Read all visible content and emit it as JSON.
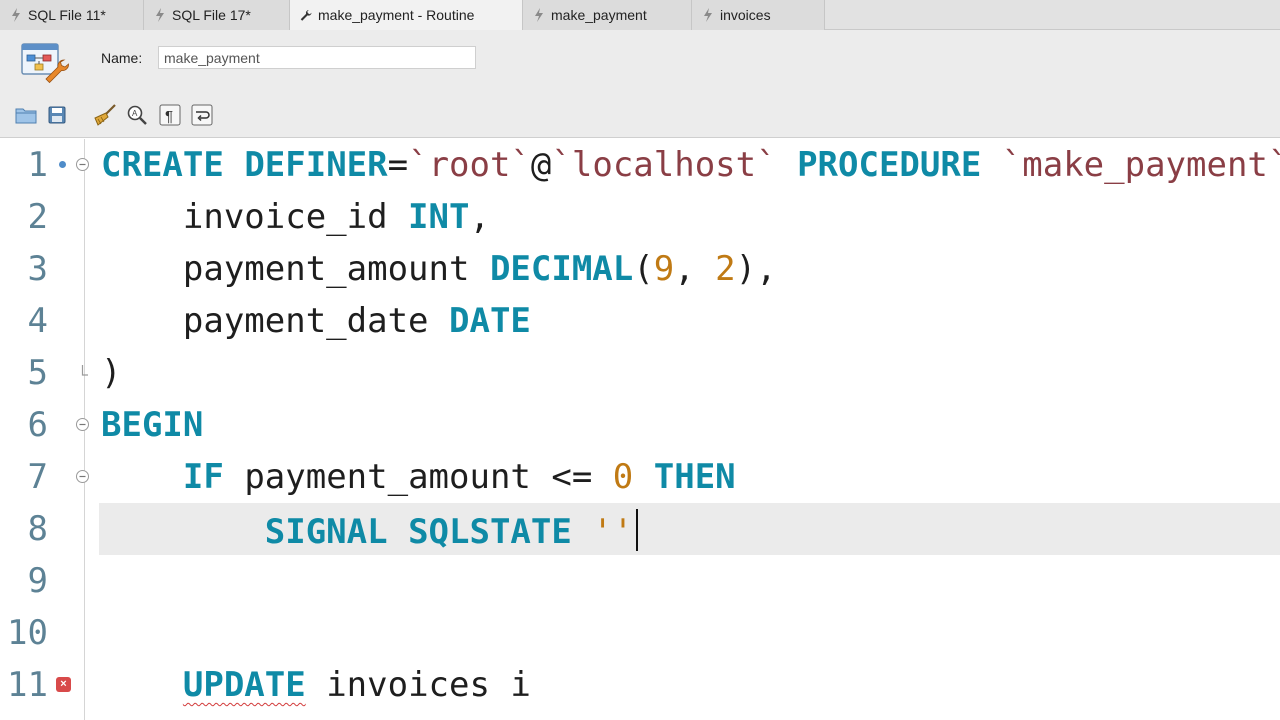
{
  "tabs": [
    {
      "label": "SQL File 11*",
      "icon": "sql-file-icon",
      "active": false
    },
    {
      "label": "SQL File 17*",
      "icon": "sql-file-icon",
      "active": false
    },
    {
      "label": "make_payment - Routine",
      "icon": "wrench-icon",
      "active": true
    },
    {
      "label": "make_payment",
      "icon": "sql-file-icon",
      "active": false
    },
    {
      "label": "invoices",
      "icon": "sql-file-icon",
      "active": false
    }
  ],
  "routine": {
    "name_label": "Name:",
    "name_value": "make_payment"
  },
  "toolbar": [
    "open-folder-icon",
    "save-icon",
    "beautify-broom-icon",
    "find-replace-icon",
    "invisible-chars-icon",
    "word-wrap-icon"
  ],
  "editor": {
    "line_numbers": [
      "1",
      "2",
      "3",
      "4",
      "5",
      "6",
      "7",
      "8",
      "9",
      "10",
      "11"
    ],
    "current_line": 8,
    "error_line": 11,
    "l1": {
      "t0": "CREATE",
      "t1": " ",
      "t2": "DEFINER",
      "t3": "=",
      "t4": "`root`",
      "t5": "@",
      "t6": "`localhost`",
      "t7": " ",
      "t8": "PROCEDURE",
      "t9": " ",
      "t10": "`make_payment`"
    },
    "l2": {
      "t0": "    invoice_id ",
      "t1": "INT",
      "t2": ","
    },
    "l3": {
      "t0": "    payment_amount ",
      "t1": "DECIMAL",
      "t2": "(",
      "t3": "9",
      "t4": ", ",
      "t5": "2",
      "t6": "),"
    },
    "l4": {
      "t0": "    payment_date ",
      "t1": "DATE"
    },
    "l5": {
      "t0": ")"
    },
    "l6": {
      "t0": "BEGIN"
    },
    "l7": {
      "t0": "    ",
      "t1": "IF",
      "t2": " payment_amount <= ",
      "t3": "0",
      "t4": " ",
      "t5": "THEN"
    },
    "l8": {
      "t0": "        ",
      "t1": "SIGNAL",
      "t2": " ",
      "t3": "SQLSTATE",
      "t4": " ",
      "t5": "''"
    },
    "l11": {
      "t0": "    ",
      "t1": "UPDATE",
      "t2": " invoices i"
    }
  }
}
